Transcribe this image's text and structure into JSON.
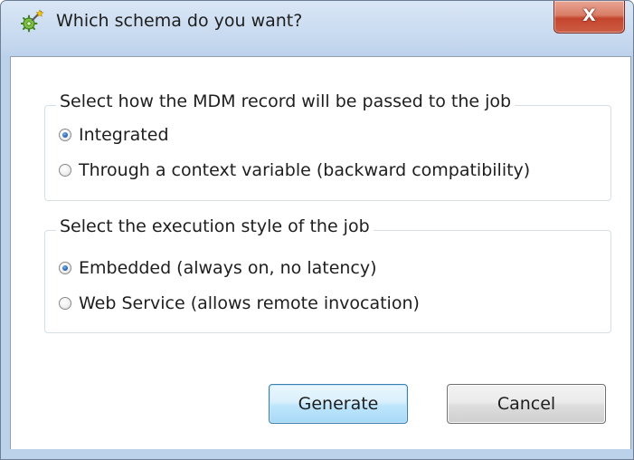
{
  "window": {
    "title": "Which schema do you want?",
    "title_icon": "gear-wand-icon",
    "close_label": "X"
  },
  "groups": [
    {
      "legend": "Select how the MDM record will be passed to the job",
      "options": [
        {
          "label": "Integrated",
          "checked": true
        },
        {
          "label": "Through a context variable (backward compatibility)",
          "checked": false
        }
      ]
    },
    {
      "legend": "Select the execution style of the job",
      "options": [
        {
          "label": "Embedded (always on, no latency)",
          "checked": true
        },
        {
          "label": "Web Service (allows remote invocation)",
          "checked": false
        }
      ]
    }
  ],
  "buttons": {
    "generate_label": "Generate",
    "cancel_label": "Cancel"
  },
  "colors": {
    "default_button_border": "#3c7fb1",
    "close_button": "#c4452d",
    "radio_selected": "#2a64b6"
  }
}
